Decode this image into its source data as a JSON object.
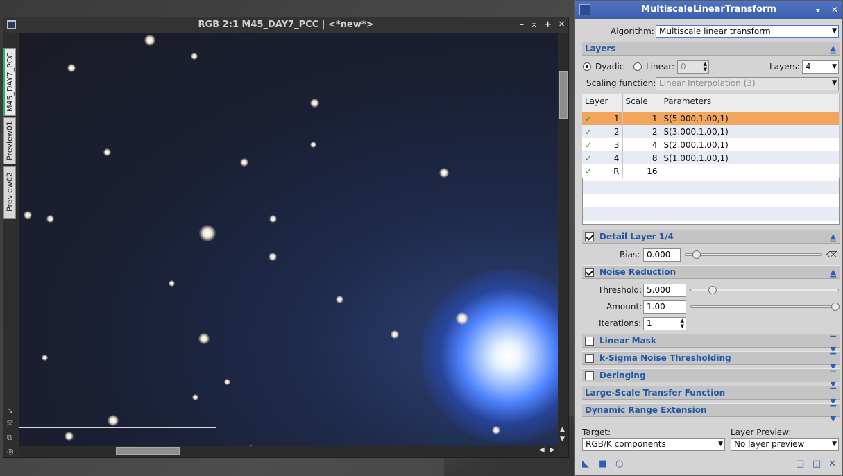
{
  "image_window": {
    "title": "RGB 2:1 M45_DAY7_PCC | <*new*>",
    "controls": [
      "–",
      "⌅",
      "+",
      "✕"
    ],
    "tabs": [
      "M45_DAY7_PCC",
      "Preview01",
      "Preview02"
    ],
    "left_tools": [
      "↘",
      "⤧",
      "⧉",
      "◎"
    ]
  },
  "process": {
    "title": "MultiscaleLinearTransform",
    "title_controls": [
      "⌅",
      "✕"
    ],
    "algorithm_label": "Algorithm:",
    "algorithm_value": "Multiscale linear transform",
    "layers_section": "Layers",
    "dyadic_label": "Dyadic",
    "linear_label": "Linear:",
    "linear_value": "0",
    "layers_label": "Layers:",
    "layers_value": "4",
    "scaling_label": "Scaling function:",
    "scaling_value": "Linear Interpolation (3)",
    "table": {
      "headers": [
        "Layer",
        "Scale",
        "Parameters"
      ],
      "rows": [
        {
          "enabled": "✓",
          "layer": "1",
          "scale": "1",
          "params": "S(5.000,1.00,1)"
        },
        {
          "enabled": "✓",
          "layer": "2",
          "scale": "2",
          "params": "S(3.000,1.00,1)"
        },
        {
          "enabled": "✓",
          "layer": "3",
          "scale": "4",
          "params": "S(2.000,1.00,1)"
        },
        {
          "enabled": "✓",
          "layer": "4",
          "scale": "8",
          "params": "S(1.000,1.00,1)"
        },
        {
          "enabled": "✓",
          "layer": "R",
          "scale": "16",
          "params": ""
        }
      ]
    },
    "detail_section": "Detail Layer 1/4",
    "bias_label": "Bias:",
    "bias_value": "0.000",
    "noise_section": "Noise Reduction",
    "threshold_label": "Threshold:",
    "threshold_value": "5.000",
    "amount_label": "Amount:",
    "amount_value": "1.00",
    "iterations_label": "Iterations:",
    "iterations_value": "1",
    "linear_mask_section": "Linear Mask",
    "ksigma_section": "k-Sigma Noise Thresholding",
    "deringing_section": "Deringing",
    "lstf_section": "Large-Scale Transfer Function",
    "dre_section": "Dynamic Range Extension",
    "target_label": "Target:",
    "target_value": "RGB/K components",
    "layer_preview_label": "Layer Preview:",
    "layer_preview_value": "No layer preview"
  }
}
